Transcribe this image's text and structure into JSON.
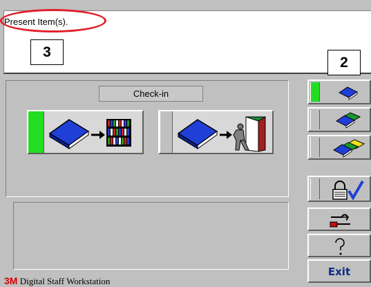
{
  "prompt": {
    "text": "Present Item(s)."
  },
  "markers": {
    "left": "3",
    "right": "2"
  },
  "mode": {
    "label": "Check-in"
  },
  "buttons": {
    "checkin_icon": "book-to-shelf-icon",
    "exit_icon": "book-to-door-icon"
  },
  "sidebar": {
    "items": [
      {
        "icon": "single-book-icon",
        "active": true
      },
      {
        "icon": "two-books-icon",
        "active": false
      },
      {
        "icon": "three-books-icon",
        "active": false
      },
      {
        "icon": "lock-check-icon",
        "active": false
      },
      {
        "icon": "tools-icon"
      },
      {
        "icon": "question-icon"
      }
    ],
    "exit_label": "Exit"
  },
  "brand": {
    "logo": "3M",
    "name": "Digital Staff Workstation"
  },
  "colors": {
    "accent_green": "#22dd22",
    "highlight_red": "#e0202a",
    "book_blue": "#1f3fd6",
    "exit_text": "#0b2b86"
  }
}
